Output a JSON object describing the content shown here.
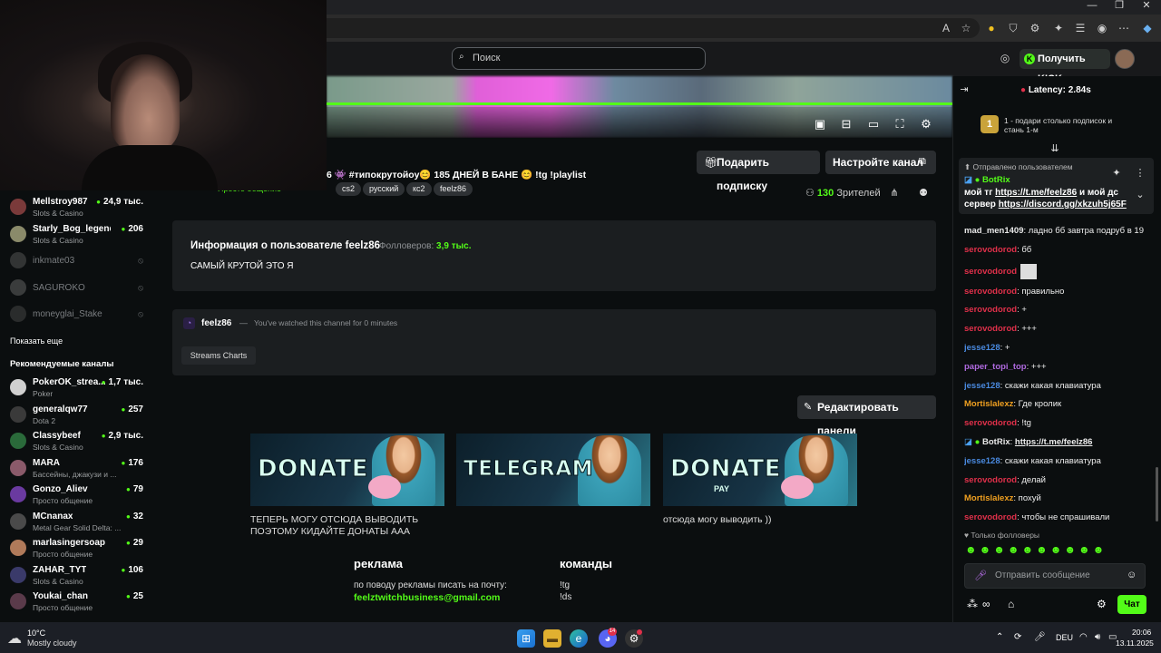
{
  "browser": {
    "search_placeholder": "Поиск",
    "get_kicks_label": "Получить KICKs"
  },
  "stream": {
    "title": "6 👾 #типокрутойоу😊 185 ДНЕЙ В БАНЕ 😊 !tg !playlist",
    "category": "Просто общение",
    "tags": [
      "cs2",
      "русский",
      "кс2",
      "feelz86"
    ],
    "gift_sub_label": "Подарить подписку",
    "setup_channel_label": "Настройте канал",
    "viewers_count": "130",
    "viewers_label": "Зрителей"
  },
  "sidebar": {
    "following": [
      {
        "name": "Mellstroy987",
        "category": "Slots & Casino",
        "count": "24,9 тыс.",
        "online": true,
        "color": "#7a3a3a"
      },
      {
        "name": "Starly_Bog_legend",
        "category": "Slots & Casino",
        "count": "206",
        "online": true,
        "color": "#8a8a6a"
      },
      {
        "name": "inkmate03",
        "online": false,
        "color": "#5a5a5a"
      },
      {
        "name": "SAGUROKO",
        "online": false,
        "color": "#6a6a6a"
      },
      {
        "name": "moneyglai_Stake",
        "online": false,
        "color": "#4a4a4a"
      }
    ],
    "show_more": "Показать еще",
    "recommended_title": "Рекомендуемые каналы",
    "recommended": [
      {
        "name": "PokerOK_strea...",
        "category": "Poker",
        "count": "1,7 тыс.",
        "color": "#d0d0d0"
      },
      {
        "name": "generalqw77",
        "category": "Dota 2",
        "count": "257",
        "color": "#3a3a3a"
      },
      {
        "name": "Classybeef",
        "category": "Slots & Casino",
        "count": "2,9 тыс.",
        "color": "#2a6a3a"
      },
      {
        "name": "MARA",
        "category": "Бассейны, джакузи и ...",
        "count": "176",
        "color": "#8a5a6a"
      },
      {
        "name": "Gonzo_Aliev",
        "category": "Просто общение",
        "count": "79",
        "color": "#6a3aa0"
      },
      {
        "name": "MCnanax",
        "category": "Metal Gear Solid Delta: ...",
        "count": "32",
        "color": "#4a4a4a"
      },
      {
        "name": "marlasingersoap",
        "category": "Просто общение",
        "count": "29",
        "color": "#b07a5a"
      },
      {
        "name": "ZAHAR_TYT",
        "category": "Slots & Casino",
        "count": "106",
        "color": "#3a3a6a"
      },
      {
        "name": "Youkai_chan",
        "category": "Просто общение",
        "count": "25",
        "color": "#5a3a4a"
      }
    ]
  },
  "about": {
    "title": "Информация о пользователе feelz86",
    "followers_label": "Фолловеров:",
    "followers_count": "3,9 тыс.",
    "bio": "САМЫЙ КРУТОЙ ЭТО Я"
  },
  "watch_panel": {
    "channel": "feelz86",
    "dash": "—",
    "text": "You've watched this channel for 0 minutes",
    "streams_charts": "Streams Charts"
  },
  "panels": {
    "edit_label": "Редактировать панели",
    "items": [
      {
        "image_text": "DONATE",
        "caption": "ТЕПЕРЬ МОГУ ОТСЮДА ВЫВОДИТЬ\nПОЭТОМУ КИДАЙТЕ ДОНАТЫ ААА"
      },
      {
        "image_text": "TELEGRAM",
        "caption": ""
      },
      {
        "image_text": "DONATE",
        "image_sub": "PAY",
        "caption": "отсюда могу выводить ))"
      }
    ],
    "ads_title": "реклама",
    "ads_text": "по поводу рекламы писать на почту:",
    "ads_email": "feelztwitchbusiness@gmail.com",
    "commands_title": "команды",
    "commands": [
      "!tg",
      "!ds"
    ]
  },
  "chat": {
    "latency": "Latency: 2.84s",
    "gift_line1": "1 - подари столько подписок и",
    "gift_line2": "стань 1-м",
    "gift_rank": "1",
    "pinned_label": "Отправлено пользователем",
    "pinned_user": "BotRix",
    "pinned_text1": "мой тг ",
    "pinned_link1": "https://t.me/feelz86",
    "pinned_text2": " и мой дс",
    "pinned_text3": "сервер ",
    "pinned_link2": "https://discord.gg/xkzuh5j65F",
    "messages": [
      {
        "user": "mad_men1409",
        "color": "#e8e8e8",
        "text": ": ладно бб завтра подруб в 19"
      },
      {
        "user": "serovodorod",
        "color": "#e0304a",
        "text": ": бб"
      },
      {
        "user": "serovodorod",
        "color": "#e0304a",
        "text": ""
      },
      {
        "user": "serovodorod",
        "color": "#e0304a",
        "text": ": правильно"
      },
      {
        "user": "serovodorod",
        "color": "#e0304a",
        "text": ": +"
      },
      {
        "user": "serovodorod",
        "color": "#e0304a",
        "text": ": +++"
      },
      {
        "user": "jesse128",
        "color": "#4a8ae0",
        "text": ": +"
      },
      {
        "user": "paper_topi_top",
        "color": "#b06ae0",
        "text": ": +++"
      },
      {
        "user": "jesse128",
        "color": "#4a8ae0",
        "text": ": скажи какая клавиатура"
      },
      {
        "user": "Mortislalexz",
        "color": "#f0a020",
        "text": ": Где кролик"
      },
      {
        "user": "serovodorod",
        "color": "#e0304a",
        "text": ": !tg"
      },
      {
        "user": "BotRix",
        "color": "#e8e8e8",
        "text": ": ",
        "link": "https://t.me/feelz86"
      },
      {
        "user": "jesse128",
        "color": "#4a8ae0",
        "text": ": скажи какая клавиатура"
      },
      {
        "user": "serovodorod",
        "color": "#e0304a",
        "text": ": делай"
      },
      {
        "user": "Mortislalexz",
        "color": "#f0a020",
        "text": ": похуй"
      },
      {
        "user": "serovodorod",
        "color": "#e0304a",
        "text": ": чтобы не спрашивали"
      }
    ],
    "followers_only": "Только фолловеры",
    "input_placeholder": "Отправить сообщение",
    "send_label": "Чат"
  },
  "taskbar": {
    "temp": "10°C",
    "weather": "Mostly cloudy",
    "lang": "DEU",
    "time": "20:06",
    "date": "13.11.2025",
    "discord_badge": "14"
  },
  "colors": {
    "kick_green": "#53fc18",
    "bg": "#0b0e0f",
    "panel": "#1b1e20"
  }
}
